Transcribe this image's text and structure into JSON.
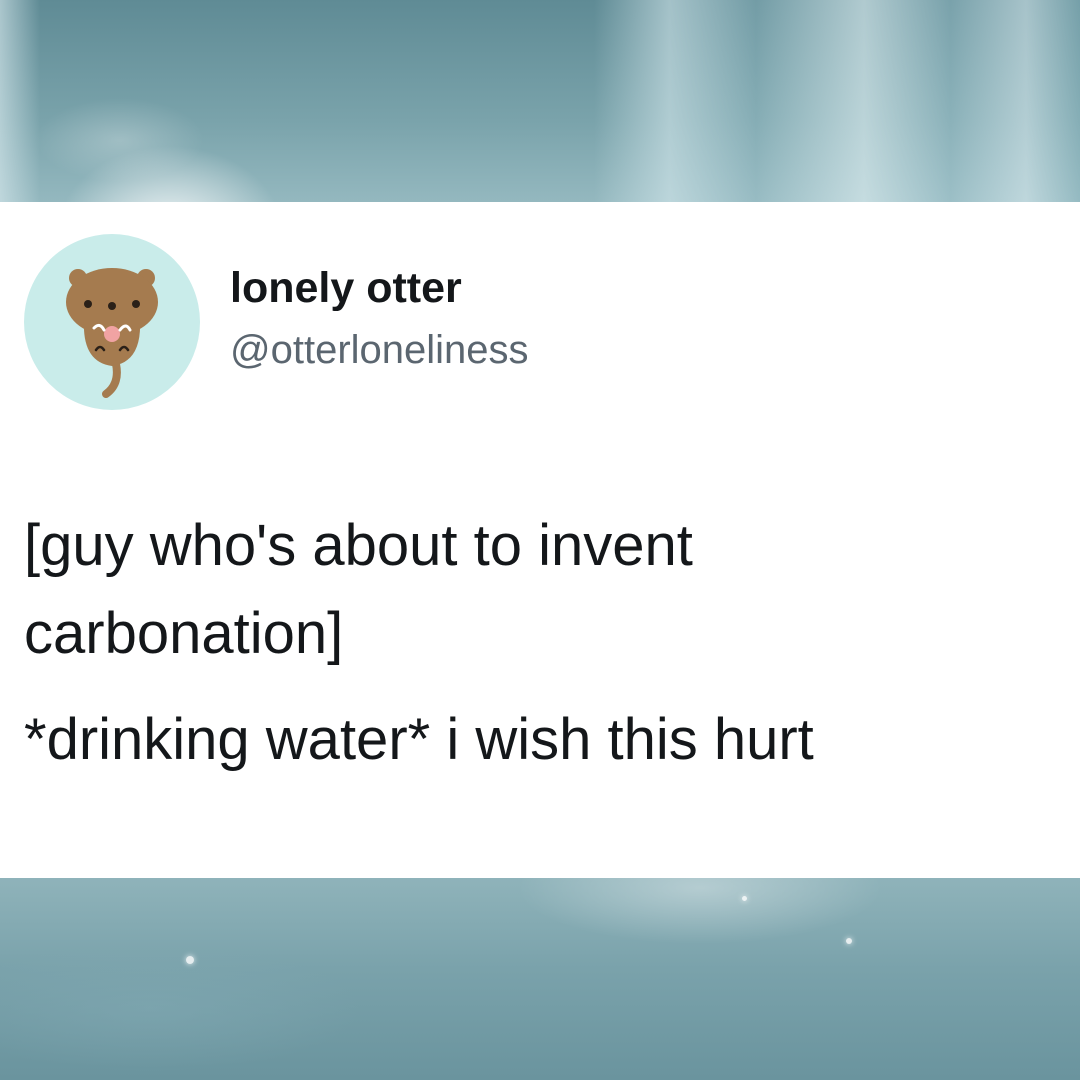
{
  "tweet": {
    "display_name": "lonely otter",
    "handle": "@otterloneliness",
    "avatar_icon": "otter-avatar-icon",
    "lines": [
      "[guy who's about to invent",
      "carbonation]",
      "*drinking water* i wish this hurt"
    ]
  },
  "colors": {
    "card_background": "#ffffff",
    "avatar_background": "#c9ecea",
    "name_text": "#14171a",
    "handle_text": "#5b6670",
    "background_tint": "#6e9aa3"
  }
}
